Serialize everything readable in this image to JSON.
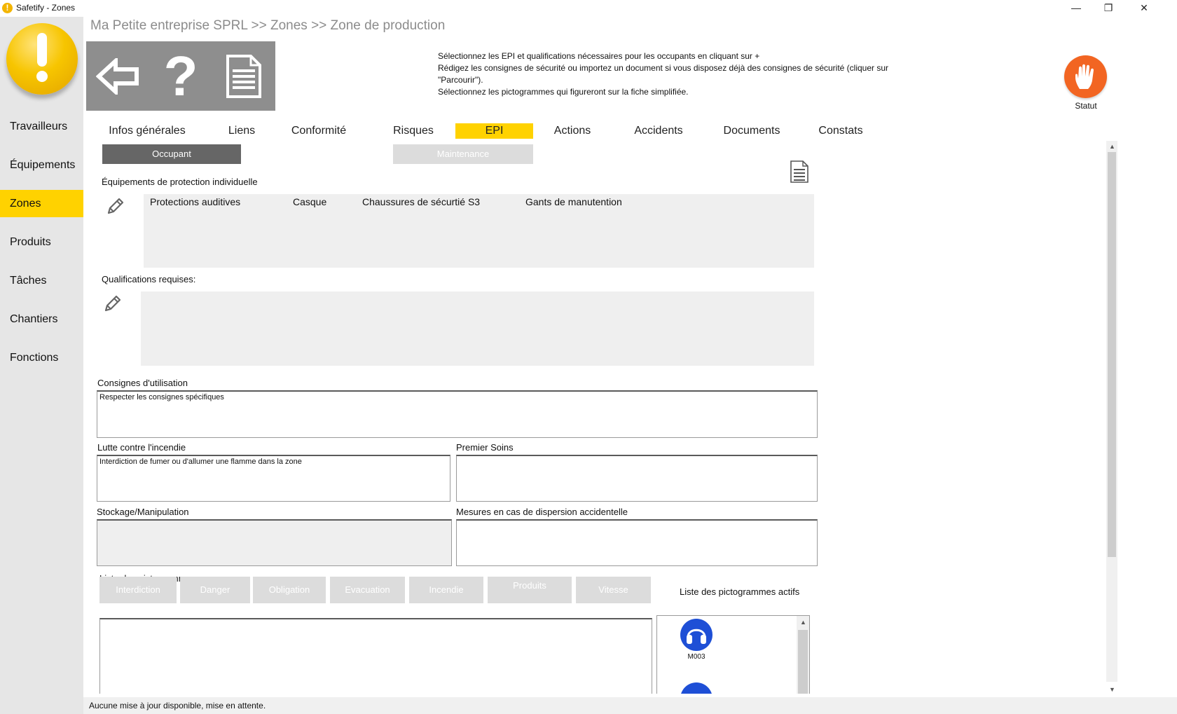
{
  "window": {
    "title": "Safetify - Zones",
    "minimize": "—",
    "restore": "❐",
    "close": "✕"
  },
  "sidebar": {
    "items": [
      {
        "label": "Travailleurs"
      },
      {
        "label": "Équipements"
      },
      {
        "label": "Zones",
        "active": true
      },
      {
        "label": "Produits"
      },
      {
        "label": "Tâches"
      },
      {
        "label": "Chantiers"
      },
      {
        "label": "Fonctions"
      }
    ]
  },
  "header": {
    "breadcrumb": "Ma Petite entreprise SPRL >> Zones >> Zone de production",
    "instructions": [
      "Sélectionnez les EPI et qualifications nécessaires pour les occupants en cliquant sur +",
      "Rédigez les consignes de sécurité ou importez un document si vous disposez déjà des consignes de sécurité (cliquer sur",
      "\"Parcourir\").",
      "Sélectionnez les pictogrammes qui figureront sur la fiche simplifiée."
    ],
    "status_label": "Statut",
    "status_color": "#f26522"
  },
  "tabs": [
    {
      "label": "Infos générales"
    },
    {
      "label": "Liens"
    },
    {
      "label": "Conformité"
    },
    {
      "label": "Risques"
    },
    {
      "label": "EPI",
      "active": true
    },
    {
      "label": "Actions"
    },
    {
      "label": "Accidents"
    },
    {
      "label": "Documents"
    },
    {
      "label": "Constats"
    }
  ],
  "subtabs": [
    {
      "label": "Occupant",
      "active": true
    },
    {
      "label": "Maintenance"
    }
  ],
  "epi": {
    "title": "Équipements de protection individuelle",
    "items": [
      "Protections auditives",
      "Casque",
      "Chaussures de sécurtié S3",
      "Gants de manutention"
    ]
  },
  "qualifications": {
    "title": "Qualifications requises:"
  },
  "fields": {
    "consignes": {
      "label": "Consignes d'utilisation",
      "value": "Respecter les consignes spécifiques"
    },
    "incendie": {
      "label": "Lutte contre l'incendie",
      "value": "Interdiction de fumer ou d'allumer une flamme dans la zone"
    },
    "soins": {
      "label": "Premier Soins",
      "value": ""
    },
    "stockage": {
      "label": "Stockage/Manipulation",
      "value": ""
    },
    "dispersion": {
      "label": "Mesures en cas de dispersion accidentelle",
      "value": ""
    }
  },
  "pictos": {
    "title": "Liste des pictogrammes",
    "categories": [
      "Interdiction",
      "Danger",
      "Obligation",
      "Evacuation",
      "Incendie",
      "Produits",
      "Vitesse"
    ],
    "active_title": "Liste des pictogrammes actifs",
    "active": [
      {
        "code": "M003"
      },
      {
        "code": ""
      }
    ]
  },
  "statusbar": {
    "text": "Aucune mise à jour disponible, mise en attente."
  }
}
